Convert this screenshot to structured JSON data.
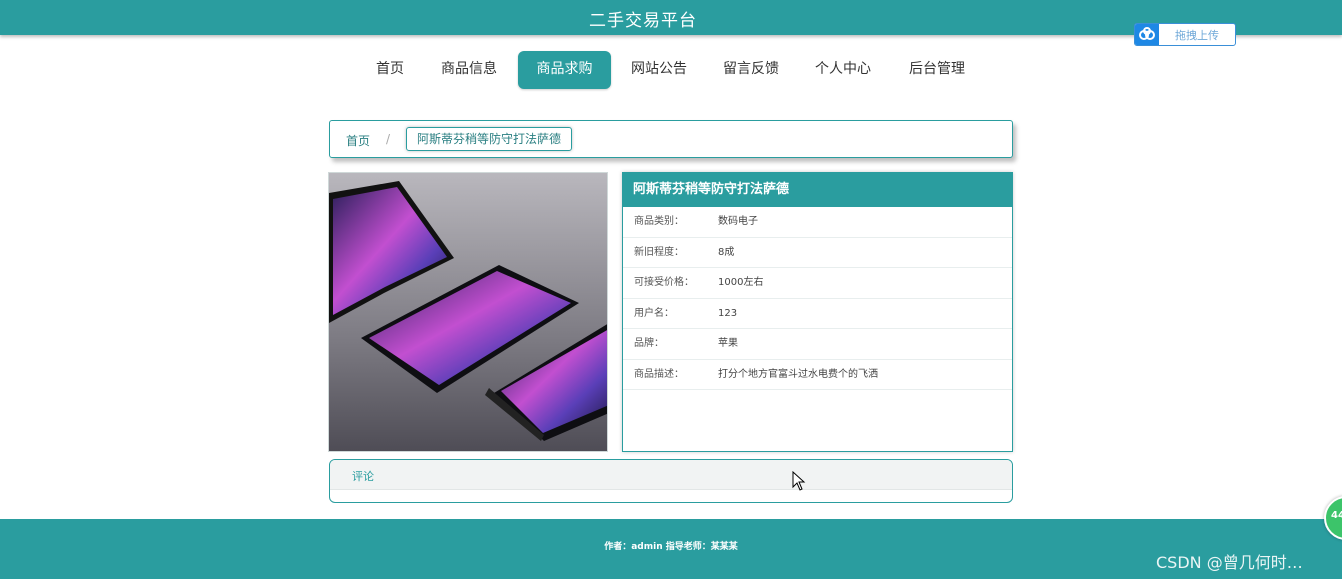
{
  "header": {
    "site_title": "二手交易平台"
  },
  "upload_button": {
    "label": "拖拽上传",
    "icon": "cloud-icon"
  },
  "nav": {
    "items": [
      {
        "label": "首页"
      },
      {
        "label": "商品信息"
      },
      {
        "label": "商品求购",
        "active": true
      },
      {
        "label": "网站公告"
      },
      {
        "label": "留言反馈"
      },
      {
        "label": "个人中心"
      },
      {
        "label": "后台管理"
      }
    ]
  },
  "breadcrumb": {
    "home": "首页",
    "separator": "/",
    "current": "阿斯蒂芬稍等防守打法萨德"
  },
  "product": {
    "title": "阿斯蒂芬稍等防守打法萨德",
    "image_alt": "foldable-tablet-photo",
    "fields": [
      {
        "key": "商品类别：",
        "value": "数码电子"
      },
      {
        "key": "新旧程度：",
        "value": "8成"
      },
      {
        "key": "可接受价格：",
        "value": "1000左右"
      },
      {
        "key": "用户名：",
        "value": "123"
      },
      {
        "key": "品牌：",
        "value": "苹果"
      },
      {
        "key": "商品描述：",
        "value": "打分个地方官富斗过水电费个的飞洒"
      }
    ]
  },
  "comments": {
    "label": "评论"
  },
  "footer": {
    "text": "作者：admin 指导老师：某某某"
  },
  "watermark": {
    "text": "CSDN @曾几何时…"
  },
  "float_widget": {
    "text": "44"
  },
  "colors": {
    "primary": "#2a9d9f",
    "upload_blue": "#1e88e5"
  }
}
